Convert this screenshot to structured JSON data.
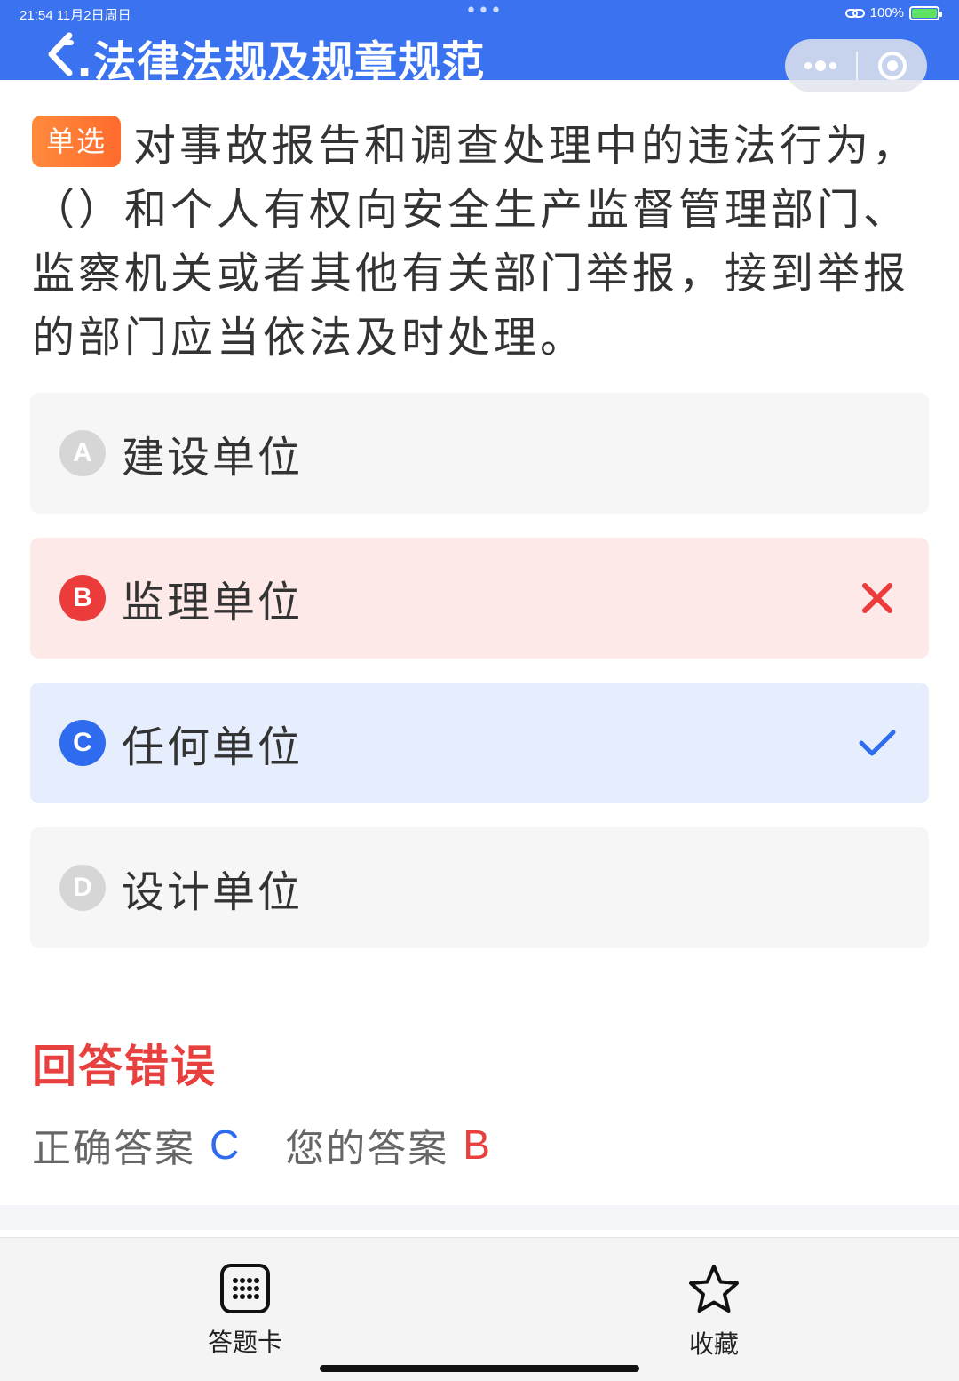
{
  "status_bar": {
    "time_date": "21:54   11月2日周日",
    "dots": "•••",
    "battery_text": "100%",
    "battery_level": 1.0
  },
  "header": {
    "title": ".法律法规及规章规范",
    "more_icon": "•••",
    "back_icon": "back-icon",
    "close_icon": "close-circle-icon",
    "accent_color": "#3a72f0"
  },
  "question": {
    "type_badge": "单选",
    "text": "对事故报告和调查处理中的违法行为，（）和个人有权向安全生产监督管理部门、监察机关或者其他有关部门举报，接到举报的部门应当依法及时处理。"
  },
  "options": [
    {
      "letter": "A",
      "text": "建设单位",
      "state": "none"
    },
    {
      "letter": "B",
      "text": "监理单位",
      "state": "wrong",
      "mark": "✕"
    },
    {
      "letter": "C",
      "text": "任何单位",
      "state": "correct",
      "mark": "✓"
    },
    {
      "letter": "D",
      "text": "设计单位",
      "state": "none"
    }
  ],
  "result": {
    "title": "回答错误",
    "correct_label": "正确答案",
    "correct_value": "C",
    "yours_label": "您的答案",
    "yours_value": "B",
    "error_color": "#e8403f",
    "correct_color": "#2f6bef"
  },
  "bottom_bar": {
    "answer_card_label": "答题卡",
    "favorite_label": "收藏"
  }
}
